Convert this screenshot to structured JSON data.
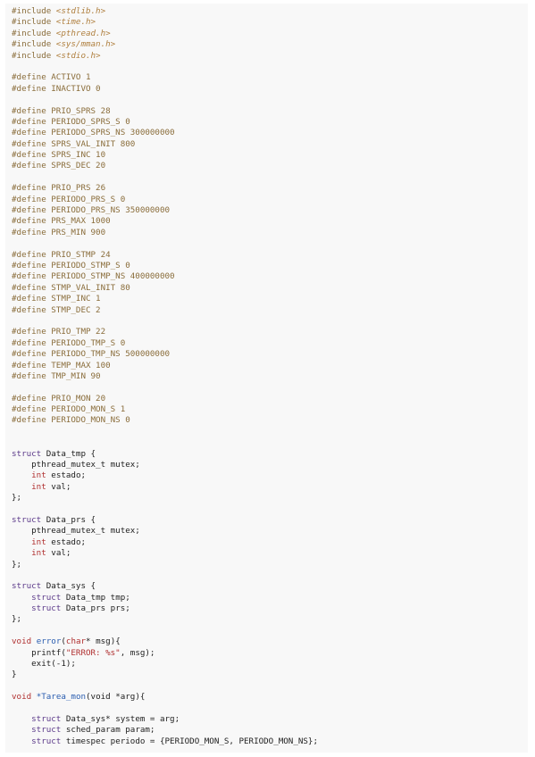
{
  "colors": {
    "background": "#ffffff",
    "code_background": "#f8f8f8",
    "directive": "#8a6d3b",
    "keyword": "#5c3a8a",
    "type": "#b03030",
    "function": "#2a5db0",
    "text": "#222222"
  },
  "code": {
    "lines": [
      [
        {
          "t": "#include ",
          "c": "directive"
        },
        {
          "t": "<stdlib.h>",
          "c": "header"
        }
      ],
      [
        {
          "t": "#include ",
          "c": "directive"
        },
        {
          "t": "<time.h>",
          "c": "header"
        }
      ],
      [
        {
          "t": "#include ",
          "c": "directive"
        },
        {
          "t": "<pthread.h>",
          "c": "header"
        }
      ],
      [
        {
          "t": "#include ",
          "c": "directive"
        },
        {
          "t": "<sys/mman.h>",
          "c": "header"
        }
      ],
      [
        {
          "t": "#include ",
          "c": "directive"
        },
        {
          "t": "<stdio.h>",
          "c": "header"
        }
      ],
      [],
      [
        {
          "t": "#define ACTIVO 1",
          "c": "macro"
        }
      ],
      [
        {
          "t": "#define INACTIVO 0",
          "c": "macro"
        }
      ],
      [],
      [
        {
          "t": "#define PRIO_SPRS 28",
          "c": "macro"
        }
      ],
      [
        {
          "t": "#define PERIODO_SPRS_S 0",
          "c": "macro"
        }
      ],
      [
        {
          "t": "#define PERIODO_SPRS_NS 300000000",
          "c": "macro"
        }
      ],
      [
        {
          "t": "#define SPRS_VAL_INIT 800",
          "c": "macro"
        }
      ],
      [
        {
          "t": "#define SPRS_INC 10",
          "c": "macro"
        }
      ],
      [
        {
          "t": "#define SPRS_DEC 20",
          "c": "macro"
        }
      ],
      [],
      [
        {
          "t": "#define PRIO_PRS 26",
          "c": "macro"
        }
      ],
      [
        {
          "t": "#define PERIODO_PRS_S 0",
          "c": "macro"
        }
      ],
      [
        {
          "t": "#define PERIODO_PRS_NS 350000000",
          "c": "macro"
        }
      ],
      [
        {
          "t": "#define PRS_MAX 1000",
          "c": "macro"
        }
      ],
      [
        {
          "t": "#define PRS_MIN 900",
          "c": "macro"
        }
      ],
      [],
      [
        {
          "t": "#define PRIO_STMP 24",
          "c": "macro"
        }
      ],
      [
        {
          "t": "#define PERIODO_STMP_S 0",
          "c": "macro"
        }
      ],
      [
        {
          "t": "#define PERIODO_STMP_NS 400000000",
          "c": "macro"
        }
      ],
      [
        {
          "t": "#define STMP_VAL_INIT 80",
          "c": "macro"
        }
      ],
      [
        {
          "t": "#define STMP_INC 1",
          "c": "macro"
        }
      ],
      [
        {
          "t": "#define STMP_DEC 2",
          "c": "macro"
        }
      ],
      [],
      [
        {
          "t": "#define PRIO_TMP 22",
          "c": "macro"
        }
      ],
      [
        {
          "t": "#define PERIODO_TMP_S 0",
          "c": "macro"
        }
      ],
      [
        {
          "t": "#define PERIODO_TMP_NS 500000000",
          "c": "macro"
        }
      ],
      [
        {
          "t": "#define TEMP_MAX 100",
          "c": "macro"
        }
      ],
      [
        {
          "t": "#define TMP_MIN 90",
          "c": "macro"
        }
      ],
      [],
      [
        {
          "t": "#define PRIO_MON 20",
          "c": "macro"
        }
      ],
      [
        {
          "t": "#define PERIODO_MON_S 1",
          "c": "macro"
        }
      ],
      [
        {
          "t": "#define PERIODO_MON_NS 0",
          "c": "macro"
        }
      ],
      [],
      [],
      [
        {
          "t": "struct",
          "c": "keyword"
        },
        {
          "t": " Data_tmp {",
          "c": "plain"
        }
      ],
      [
        {
          "t": "    pthread_mutex_t mutex;",
          "c": "plain"
        }
      ],
      [
        {
          "t": "    ",
          "c": "plain"
        },
        {
          "t": "int",
          "c": "type"
        },
        {
          "t": " estado;",
          "c": "plain"
        }
      ],
      [
        {
          "t": "    ",
          "c": "plain"
        },
        {
          "t": "int",
          "c": "type"
        },
        {
          "t": " val;",
          "c": "plain"
        }
      ],
      [
        {
          "t": "};",
          "c": "plain"
        }
      ],
      [],
      [
        {
          "t": "struct",
          "c": "keyword"
        },
        {
          "t": " Data_prs {",
          "c": "plain"
        }
      ],
      [
        {
          "t": "    pthread_mutex_t mutex;",
          "c": "plain"
        }
      ],
      [
        {
          "t": "    ",
          "c": "plain"
        },
        {
          "t": "int",
          "c": "type"
        },
        {
          "t": " estado;",
          "c": "plain"
        }
      ],
      [
        {
          "t": "    ",
          "c": "plain"
        },
        {
          "t": "int",
          "c": "type"
        },
        {
          "t": " val;",
          "c": "plain"
        }
      ],
      [
        {
          "t": "};",
          "c": "plain"
        }
      ],
      [],
      [
        {
          "t": "struct",
          "c": "keyword"
        },
        {
          "t": " Data_sys {",
          "c": "plain"
        }
      ],
      [
        {
          "t": "    ",
          "c": "plain"
        },
        {
          "t": "struct",
          "c": "keyword"
        },
        {
          "t": " Data_tmp tmp;",
          "c": "plain"
        }
      ],
      [
        {
          "t": "    ",
          "c": "plain"
        },
        {
          "t": "struct",
          "c": "keyword"
        },
        {
          "t": " Data_prs prs;",
          "c": "plain"
        }
      ],
      [
        {
          "t": "};",
          "c": "plain"
        }
      ],
      [],
      [
        {
          "t": "void",
          "c": "type"
        },
        {
          "t": " ",
          "c": "plain"
        },
        {
          "t": "error",
          "c": "func"
        },
        {
          "t": "(",
          "c": "plain"
        },
        {
          "t": "char",
          "c": "type"
        },
        {
          "t": "* msg){",
          "c": "plain"
        }
      ],
      [
        {
          "t": "    printf(",
          "c": "plain"
        },
        {
          "t": "\"ERROR: %s\"",
          "c": "string"
        },
        {
          "t": ", msg);",
          "c": "plain"
        }
      ],
      [
        {
          "t": "    exit(-1);",
          "c": "plain"
        }
      ],
      [
        {
          "t": "}",
          "c": "plain"
        }
      ],
      [],
      [
        {
          "t": "void",
          "c": "type"
        },
        {
          "t": " ",
          "c": "plain"
        },
        {
          "t": "*Tarea_mon",
          "c": "func"
        },
        {
          "t": "(void *arg){",
          "c": "plain"
        }
      ],
      [],
      [
        {
          "t": "    ",
          "c": "plain"
        },
        {
          "t": "struct",
          "c": "keyword"
        },
        {
          "t": " Data_sys* system = arg;",
          "c": "plain"
        }
      ],
      [
        {
          "t": "    ",
          "c": "plain"
        },
        {
          "t": "struct",
          "c": "keyword"
        },
        {
          "t": " sched_param param;",
          "c": "plain"
        }
      ],
      [
        {
          "t": "    ",
          "c": "plain"
        },
        {
          "t": "struct",
          "c": "keyword"
        },
        {
          "t": " timespec periodo = {PERIODO_MON_S, PERIODO_MON_NS};",
          "c": "plain"
        }
      ]
    ]
  }
}
